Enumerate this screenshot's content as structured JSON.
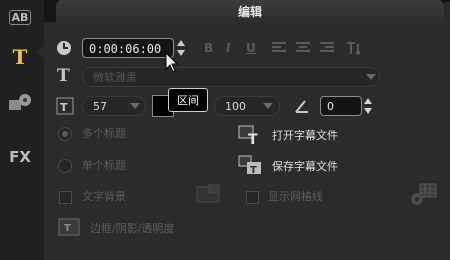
{
  "sidebar": {
    "items": [
      {
        "label": "AB",
        "icon": "ab-icon"
      },
      {
        "label": "T",
        "icon": "title-icon"
      },
      {
        "label": "",
        "icon": "video-effect-icon"
      },
      {
        "label": "FX",
        "icon": "fx-icon"
      }
    ]
  },
  "tabs": {
    "edit_label": "编辑"
  },
  "duration": {
    "value": "0:00:06:00",
    "tooltip": "区间"
  },
  "font": {
    "placeholder": "微软雅黑"
  },
  "size": {
    "value": "57"
  },
  "color": {
    "value": "#000000"
  },
  "line_spacing": {
    "value": "100"
  },
  "angle": {
    "value": "0"
  },
  "title_mode": {
    "multi_label": "多个标题",
    "single_label": "单个标题",
    "selected": "multi"
  },
  "files": {
    "open_label": "打开字幕文件",
    "save_label": "保存字幕文件"
  },
  "options": {
    "text_bg_label": "文字背景",
    "gridlines_label": "显示网格线"
  },
  "border": {
    "label": "边框/阴影/透明度"
  }
}
